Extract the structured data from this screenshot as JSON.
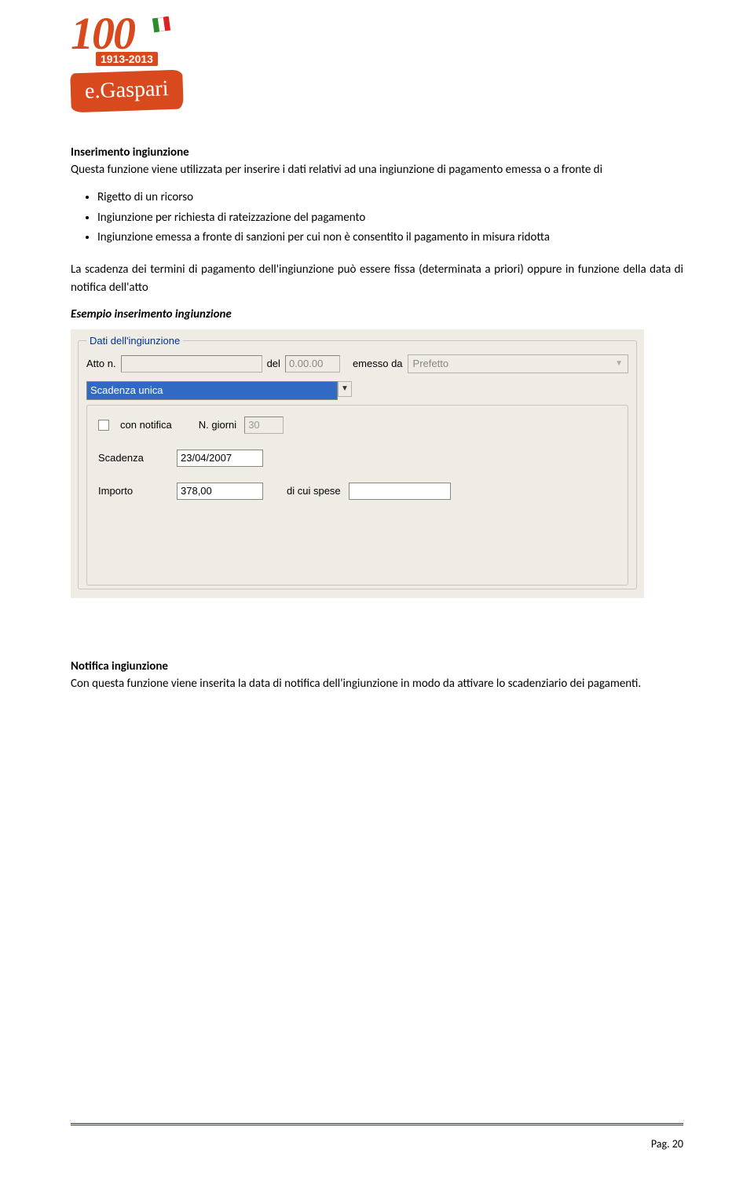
{
  "logo": {
    "number": "100",
    "years": "1913-2013",
    "brand": "e.Gaspari"
  },
  "section1": {
    "title": "Inserimento ingiunzione",
    "p1": "Questa funzione viene utilizzata per inserire i dati relativi ad una ingiunzione di pagamento emessa o a fronte di",
    "bullets": [
      "Rigetto di un ricorso",
      "Ingiunzione per richiesta di rateizzazione del pagamento",
      "Ingiunzione emessa a fronte di sanzioni per cui non è consentito il pagamento in misura ridotta"
    ],
    "p2": "La scadenza dei termini di pagamento dell'ingiunzione può essere fissa (determinata a priori) oppure in funzione della data di notifica dell'atto",
    "example": "Esempio inserimento ingiunzione"
  },
  "form": {
    "legend": "Dati dell'ingiunzione",
    "atto_label": "Atto n.",
    "atto_value": "",
    "del_label": "del",
    "del_value": "0.00.00",
    "emesso_label": "emesso da",
    "emesso_value": "Prefetto",
    "scad_type": "Scadenza unica",
    "con_notifica_label": "con notifica",
    "con_notifica_checked": false,
    "ngiorni_label": "N. giorni",
    "ngiorni_value": "30",
    "scadenza_label": "Scadenza",
    "scadenza_value": "23/04/2007",
    "importo_label": "Importo",
    "importo_value": "378,00",
    "spese_label": "di cui spese",
    "spese_value": ""
  },
  "section2": {
    "title": "Notifica ingiunzione",
    "p1": "Con questa funzione viene inserita la data di notifica dell'ingiunzione in modo da attivare lo scadenziario dei pagamenti."
  },
  "footer": {
    "page": "Pag. 20"
  }
}
